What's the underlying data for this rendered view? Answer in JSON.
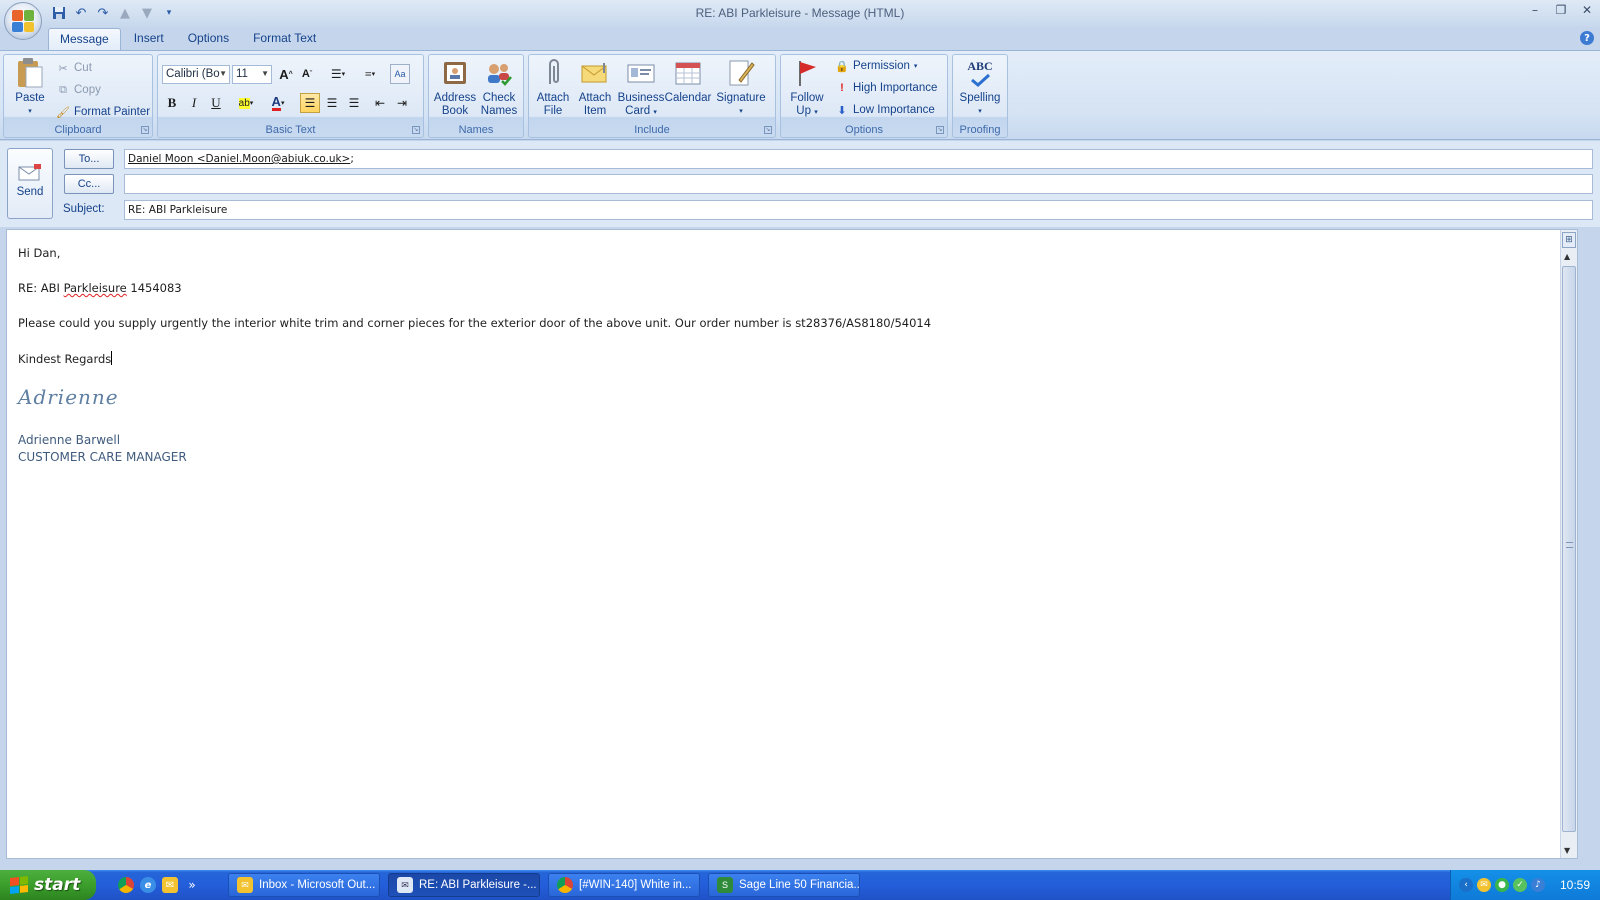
{
  "window": {
    "title": "RE: ABI Parkleisure  - Message (HTML)"
  },
  "tabs": [
    {
      "label": "Message"
    },
    {
      "label": "Insert"
    },
    {
      "label": "Options"
    },
    {
      "label": "Format Text"
    }
  ],
  "ribbon": {
    "clipboard": {
      "label": "Clipboard",
      "paste": "Paste",
      "cut": "Cut",
      "copy": "Copy",
      "format_painter": "Format Painter"
    },
    "basic_text": {
      "label": "Basic Text",
      "font": "Calibri (Bo",
      "size": "11"
    },
    "names": {
      "label": "Names",
      "address_book_1": "Address",
      "address_book_2": "Book",
      "check_names_1": "Check",
      "check_names_2": "Names"
    },
    "include": {
      "label": "Include",
      "attach_file_1": "Attach",
      "attach_file_2": "File",
      "attach_item_1": "Attach",
      "attach_item_2": "Item",
      "business_card_1": "Business",
      "business_card_2": "Card",
      "calendar": "Calendar",
      "signature": "Signature"
    },
    "options": {
      "label": "Options",
      "follow_up_1": "Follow",
      "follow_up_2": "Up",
      "permission": "Permission",
      "high_importance": "High Importance",
      "low_importance": "Low Importance"
    },
    "proofing": {
      "label": "Proofing",
      "spelling": "Spelling",
      "abc": "ABC"
    }
  },
  "header": {
    "send": "Send",
    "to_button": "To...",
    "cc_button": "Cc...",
    "subject_label": "Subject:",
    "to_value": "Daniel Moon <Daniel.Moon@abiuk.co.uk>",
    "to_sep": ";",
    "cc_value": "",
    "subject_value": "RE: ABI Parkleisure"
  },
  "body": {
    "greeting": "Hi Dan,",
    "ref_prefix": "RE: ABI ",
    "ref_word": "Parkleisure",
    "ref_suffix": " 1454083",
    "request": "Please could you supply urgently the interior white trim and corner pieces for the exterior door of the above unit.  Our order number is   st28376/AS8180/54014",
    "closing": "Kindest Regards",
    "signature_script": "Adrienne",
    "sig_name": "Adrienne Barwell",
    "sig_title": "CUSTOMER CARE MANAGER"
  },
  "taskbar": {
    "start": "start",
    "tasks": [
      {
        "label": "Inbox - Microsoft Out..."
      },
      {
        "label": "RE: ABI Parkleisure  -..."
      },
      {
        "label": "[#WIN-140] White in..."
      },
      {
        "label": "Sage Line 50 Financia..."
      }
    ],
    "clock": "10:59",
    "overflow": "»"
  }
}
